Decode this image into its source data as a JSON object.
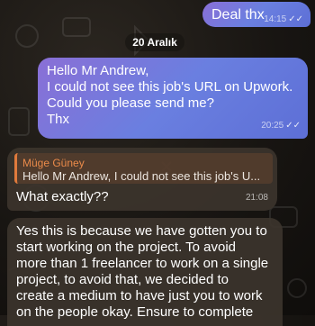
{
  "chat": {
    "date_separator": "20 Aralık",
    "messages": [
      {
        "direction": "out",
        "text": "Deal thx",
        "time": "14:15",
        "ticks": "✓✓"
      },
      {
        "direction": "out",
        "lines": [
          "Hello Mr Andrew,",
          "I could not see this job's URL on Upwork.",
          "Could you please send me?",
          "Thx"
        ],
        "time": "20:25",
        "ticks": "✓✓"
      },
      {
        "direction": "in",
        "reply": {
          "sender": "Müge Güney",
          "preview": "Hello Mr Andrew, I could not see this job's U..."
        },
        "text": "What exactly??",
        "time": "21:08"
      },
      {
        "direction": "in",
        "lines": [
          "Yes this is because we have gotten you to",
          "start working on the project. To avoid",
          "more than 1 freelancer to work on a single",
          "project, to avoid that, we decided to",
          "create a medium to have just you to work",
          "on the people okay. Ensure to complete"
        ]
      }
    ]
  },
  "colors": {
    "outgoing_bubble": "#6f78dc",
    "incoming_bubble": "#3c342d",
    "reply_accent": "#e07a3c",
    "reply_sender": "#e98a4a"
  }
}
